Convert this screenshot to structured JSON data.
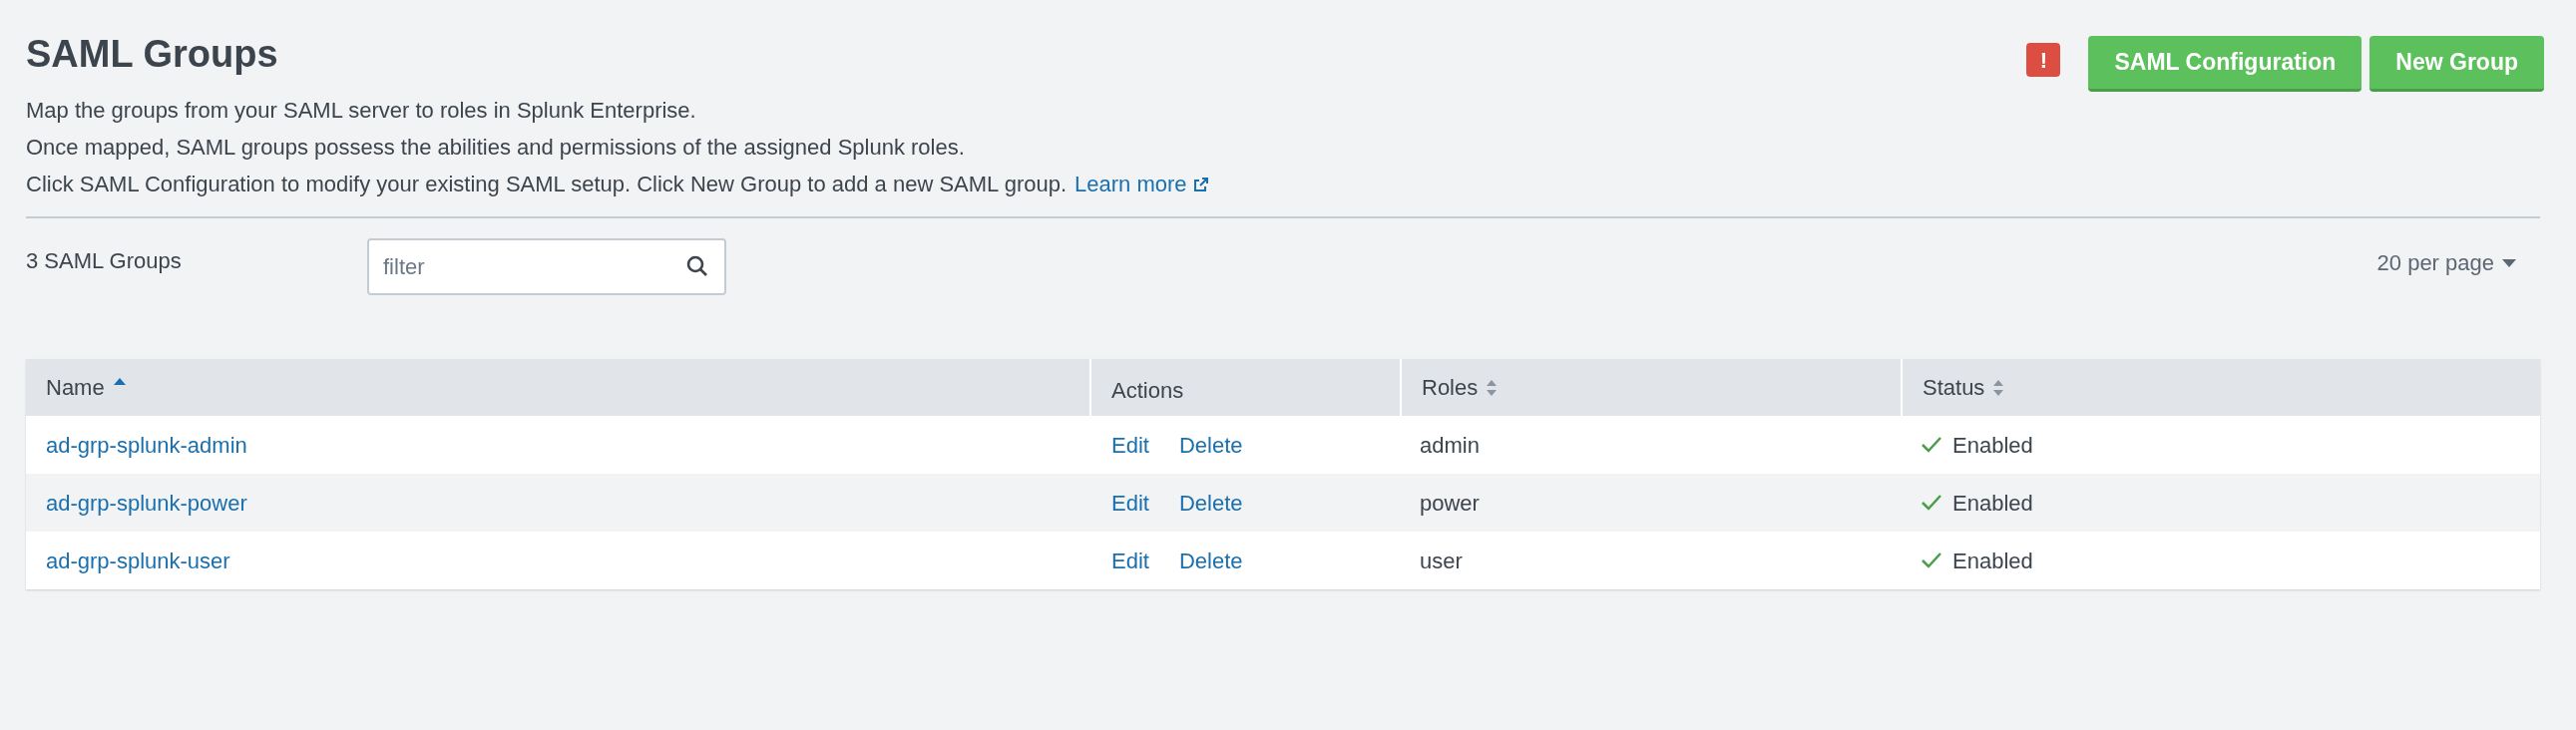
{
  "header": {
    "title": "SAML Groups",
    "description": [
      "Map the groups from your SAML server to roles in Splunk Enterprise.",
      "Once mapped, SAML groups possess the abilities and permissions of the assigned Splunk roles.",
      "Click SAML Configuration to modify your existing SAML setup. Click New Group to add a new SAML group."
    ],
    "learn_more": "Learn more",
    "alert": "!",
    "buttons": [
      "SAML Configuration",
      "New Group"
    ]
  },
  "toolbar": {
    "count": "3 SAML Groups",
    "filter": {
      "placeholder": "filter"
    },
    "per_page": "20 per page"
  },
  "table": {
    "columns": [
      {
        "label": "Name",
        "kind": "sorted"
      },
      {
        "label": "Actions",
        "kind": "plain"
      },
      {
        "label": "Roles",
        "kind": "sortable"
      },
      {
        "label": "Status",
        "kind": "sortable"
      }
    ],
    "rows": [
      {
        "name": "ad-grp-splunk-admin",
        "actions": [
          "Edit",
          "Delete"
        ],
        "roles": "admin",
        "status": "Enabled",
        "enabled": true
      },
      {
        "name": "ad-grp-splunk-power",
        "actions": [
          "Edit",
          "Delete"
        ],
        "roles": "power",
        "status": "Enabled",
        "enabled": true
      },
      {
        "name": "ad-grp-splunk-user",
        "actions": [
          "Edit",
          "Delete"
        ],
        "roles": "user",
        "status": "Enabled",
        "enabled": true
      }
    ]
  }
}
